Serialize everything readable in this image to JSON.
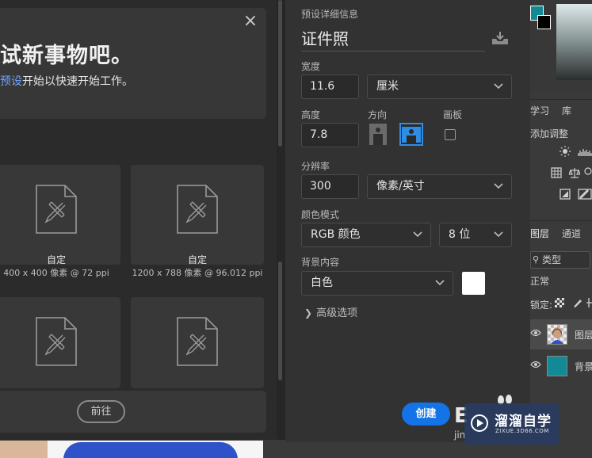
{
  "dialog": {
    "hero": {
      "title": "试新事物吧。",
      "subtitle_link": "预设",
      "subtitle_rest": "开始以快速开始工作。"
    },
    "close_label": "×",
    "presets": [
      {
        "name": "自定",
        "size": "400 x 400 像素 @ 72 ppi"
      },
      {
        "name": "自定",
        "size": "1200 x 788 像素 @ 96.012 ppi"
      },
      {
        "name": "",
        "size": ""
      },
      {
        "name": "",
        "size": ""
      }
    ],
    "goto_label": "前往"
  },
  "details": {
    "section_label": "预设详细信息",
    "preset_name": "证件照",
    "width_label": "宽度",
    "width_value": "11.6",
    "width_unit": "厘米",
    "height_label": "高度",
    "height_value": "7.8",
    "orientation_label": "方向",
    "artboard_label": "画板",
    "resolution_label": "分辨率",
    "resolution_value": "300",
    "resolution_unit": "像素/英寸",
    "color_mode_label": "颜色模式",
    "color_mode": "RGB 颜色",
    "bit_depth": "8 位",
    "background_label": "背景内容",
    "background_value": "白色",
    "background_color": "#ffffff",
    "advanced_label": "高级选项",
    "create_label": "创建"
  },
  "watermark": {
    "title": "溜溜自学",
    "url": "ZIXUE.3D66.COM",
    "letter": "E",
    "sub": "jin"
  },
  "photoshop_panels": {
    "foreground_color": "#118a96",
    "background_color": "#000000",
    "tabs_top": [
      "学习",
      "库"
    ],
    "adjust_label": "添加调整",
    "tabs_layers": [
      "图层",
      "通道"
    ],
    "kind_filter": "类型",
    "blend_mode": "正常",
    "lock_label": "锁定:",
    "layers": [
      {
        "name": "图层",
        "selected": true
      },
      {
        "name": "背景",
        "selected": false
      }
    ]
  },
  "colors": {
    "accent": "#1473e6",
    "link": "#6ea4ff",
    "selected_outline": "#2f8de4"
  }
}
